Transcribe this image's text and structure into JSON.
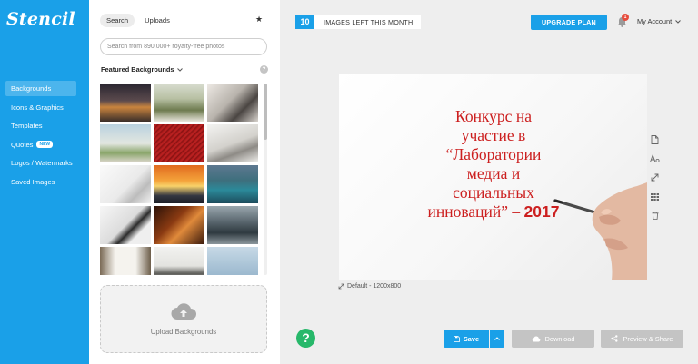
{
  "app": {
    "logo": "Stencil",
    "brand_color": "#1aa0e8"
  },
  "sidebar": {
    "items": [
      {
        "label": "Backgrounds",
        "active": true
      },
      {
        "label": "Icons & Graphics"
      },
      {
        "label": "Templates"
      },
      {
        "label": "Quotes",
        "badge": "NEW"
      },
      {
        "label": "Logos / Watermarks"
      },
      {
        "label": "Saved Images"
      }
    ]
  },
  "panel": {
    "tabs": [
      {
        "label": "Search",
        "active": true
      },
      {
        "label": "Uploads"
      }
    ],
    "favorites_icon": "star-icon",
    "search": {
      "placeholder": "Search from 890,000+ royalty-free photos",
      "value": ""
    },
    "featured_label": "Featured Backgrounds",
    "help_label": "?",
    "upload_label": "Upload Backgrounds",
    "upload_icon": "cloud-upload-icon"
  },
  "topbar": {
    "images_left_count": "10",
    "images_left_label": "IMAGES LEFT THIS MONTH",
    "upgrade_label": "UPGRADE PLAN",
    "notification_count": "1",
    "account_label": "My Account"
  },
  "canvas": {
    "lines": [
      "Конкурс на",
      "участие в",
      "“Лаборатории",
      "медиа и",
      "социальных"
    ],
    "last_line": "инноваций” – ",
    "year": "2017",
    "text_color": "#cc1f1f",
    "size_label": "Default - 1200x800"
  },
  "tools": [
    "page-icon",
    "text-format-icon",
    "resize-icon",
    "grid-icon",
    "trash-icon"
  ],
  "bottombar": {
    "help_label": "?",
    "save_label": "Save",
    "download_label": "Download",
    "preview_label": "Preview & Share",
    "help_color": "#27b86a"
  }
}
